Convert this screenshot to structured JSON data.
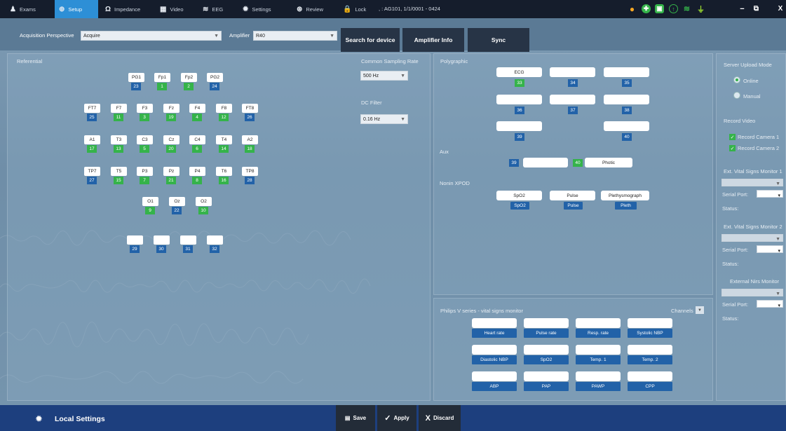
{
  "nav": {
    "tabs": [
      {
        "label": "Exams",
        "icon": "person-icon",
        "active": false
      },
      {
        "label": "Setup",
        "icon": "setup-icon",
        "active": true
      },
      {
        "label": "Impedance",
        "icon": "omega-icon",
        "active": false
      },
      {
        "label": "Video",
        "icon": "video-icon",
        "active": false
      },
      {
        "label": "EEG",
        "icon": "eeg-icon",
        "active": false
      },
      {
        "label": "Settings",
        "icon": "gear-icon",
        "active": false
      },
      {
        "label": "Review",
        "icon": "review-icon",
        "active": false
      },
      {
        "label": "Lock",
        "icon": "lock-icon",
        "active": false
      }
    ],
    "session": ", : AG101, 1/1/0001 - 0424"
  },
  "status_icons": [
    "orange-dot-icon",
    "network-icon",
    "monitor-icon",
    "upload-icon",
    "wifi-icon",
    "plug-icon"
  ],
  "toolbar": {
    "perspective_label": "Acquisition Perspective",
    "perspective_value": "Acquire",
    "amplifier_label": "Amplifier",
    "amplifier_value": "R40",
    "search_button": "Search for device",
    "info_button": "Amplifier Info",
    "sync_button": "Sync"
  },
  "referential": {
    "title": "Referential",
    "channels": [
      {
        "label": "PG1",
        "num": "23",
        "color": "b"
      },
      {
        "label": "Fp1",
        "num": "1",
        "color": "g"
      },
      {
        "label": "Fp2",
        "num": "2",
        "color": "g"
      },
      {
        "label": "PG2",
        "num": "24",
        "color": "b"
      },
      {
        "label": "FT7",
        "num": "25",
        "color": "b"
      },
      {
        "label": "F7",
        "num": "11",
        "color": "g"
      },
      {
        "label": "F3",
        "num": "3",
        "color": "g"
      },
      {
        "label": "Fz",
        "num": "19",
        "color": "g"
      },
      {
        "label": "F4",
        "num": "4",
        "color": "g"
      },
      {
        "label": "F8",
        "num": "12",
        "color": "g"
      },
      {
        "label": "FT8",
        "num": "26",
        "color": "b"
      },
      {
        "label": "A1",
        "num": "17",
        "color": "g"
      },
      {
        "label": "T3",
        "num": "13",
        "color": "g"
      },
      {
        "label": "C3",
        "num": "5",
        "color": "g"
      },
      {
        "label": "Cz",
        "num": "20",
        "color": "g"
      },
      {
        "label": "C4",
        "num": "6",
        "color": "g"
      },
      {
        "label": "T4",
        "num": "14",
        "color": "g"
      },
      {
        "label": "A2",
        "num": "18",
        "color": "g"
      },
      {
        "label": "TP7",
        "num": "27",
        "color": "b"
      },
      {
        "label": "T5",
        "num": "15",
        "color": "g"
      },
      {
        "label": "P3",
        "num": "7",
        "color": "g"
      },
      {
        "label": "Pz",
        "num": "21",
        "color": "g"
      },
      {
        "label": "P4",
        "num": "8",
        "color": "g"
      },
      {
        "label": "T6",
        "num": "16",
        "color": "g"
      },
      {
        "label": "TP8",
        "num": "28",
        "color": "b"
      },
      {
        "label": "O1",
        "num": "9",
        "color": "g"
      },
      {
        "label": "Oz",
        "num": "22",
        "color": "b"
      },
      {
        "label": "O2",
        "num": "10",
        "color": "g"
      },
      {
        "label": "",
        "num": "29",
        "color": "b"
      },
      {
        "label": "",
        "num": "30",
        "color": "b"
      },
      {
        "label": "",
        "num": "31",
        "color": "b"
      },
      {
        "label": "",
        "num": "32",
        "color": "b"
      }
    ],
    "sampling_label": "Common Sampling Rate",
    "sampling_value": "500 Hz",
    "dc_label": "DC Filter",
    "dc_value": "0.16 Hz"
  },
  "polygraphic": {
    "title": "Polygraphic",
    "boxes": [
      {
        "label": "ECG",
        "num": "33",
        "color": "g"
      },
      {
        "label": "",
        "num": "34",
        "color": "b"
      },
      {
        "label": "",
        "num": "35",
        "color": "b"
      },
      {
        "label": "",
        "num": "36",
        "color": "b"
      },
      {
        "label": "",
        "num": "37",
        "color": "b"
      },
      {
        "label": "",
        "num": "38",
        "color": "b"
      },
      {
        "label": "",
        "num": "39",
        "color": "b"
      },
      {
        "label": "",
        "num": "40",
        "color": "b"
      }
    ],
    "aux_title": "Aux",
    "aux": [
      {
        "num": "39",
        "label": ""
      },
      {
        "num": "40",
        "label": "Photic"
      }
    ],
    "nonin_title": "Nonin XPOD",
    "nonin": [
      {
        "label": "SpO2",
        "tag": "SpO2"
      },
      {
        "label": "Pulse",
        "tag": "Pulse"
      },
      {
        "label": "Plethysmograph",
        "tag": "Pleth"
      }
    ]
  },
  "philips": {
    "title": "Philips V series - vital signs monitor",
    "channels_label": "Channels",
    "items": [
      "Heart rate",
      "Pulse rate",
      "Resp. rate",
      "Systolic NBP",
      "Diastolic NBP",
      "SpO2",
      "Temp. 1",
      "Temp. 2",
      "ABP",
      "PAP",
      "PAWP",
      "CPP"
    ]
  },
  "side": {
    "upload_title": "Server Upload Mode",
    "online": "Online",
    "manual": "Manual",
    "video_title": "Record Video",
    "cam1": "Record Camera 1",
    "cam2": "Record Camera 2",
    "monitors": [
      {
        "title": "Ext. Vital Signs Monitor 1",
        "serial": "Serial Port:",
        "status": "Status:"
      },
      {
        "title": "Ext. Vital Signs Monitor 2",
        "serial": "Serial Port:",
        "status": "Status:"
      },
      {
        "title": "External Nirs Monitor",
        "serial": "Serial Port:",
        "status": "Status:"
      }
    ]
  },
  "footer": {
    "title": "Local Settings",
    "save": "Save",
    "apply": "Apply",
    "discard": "Discard"
  }
}
